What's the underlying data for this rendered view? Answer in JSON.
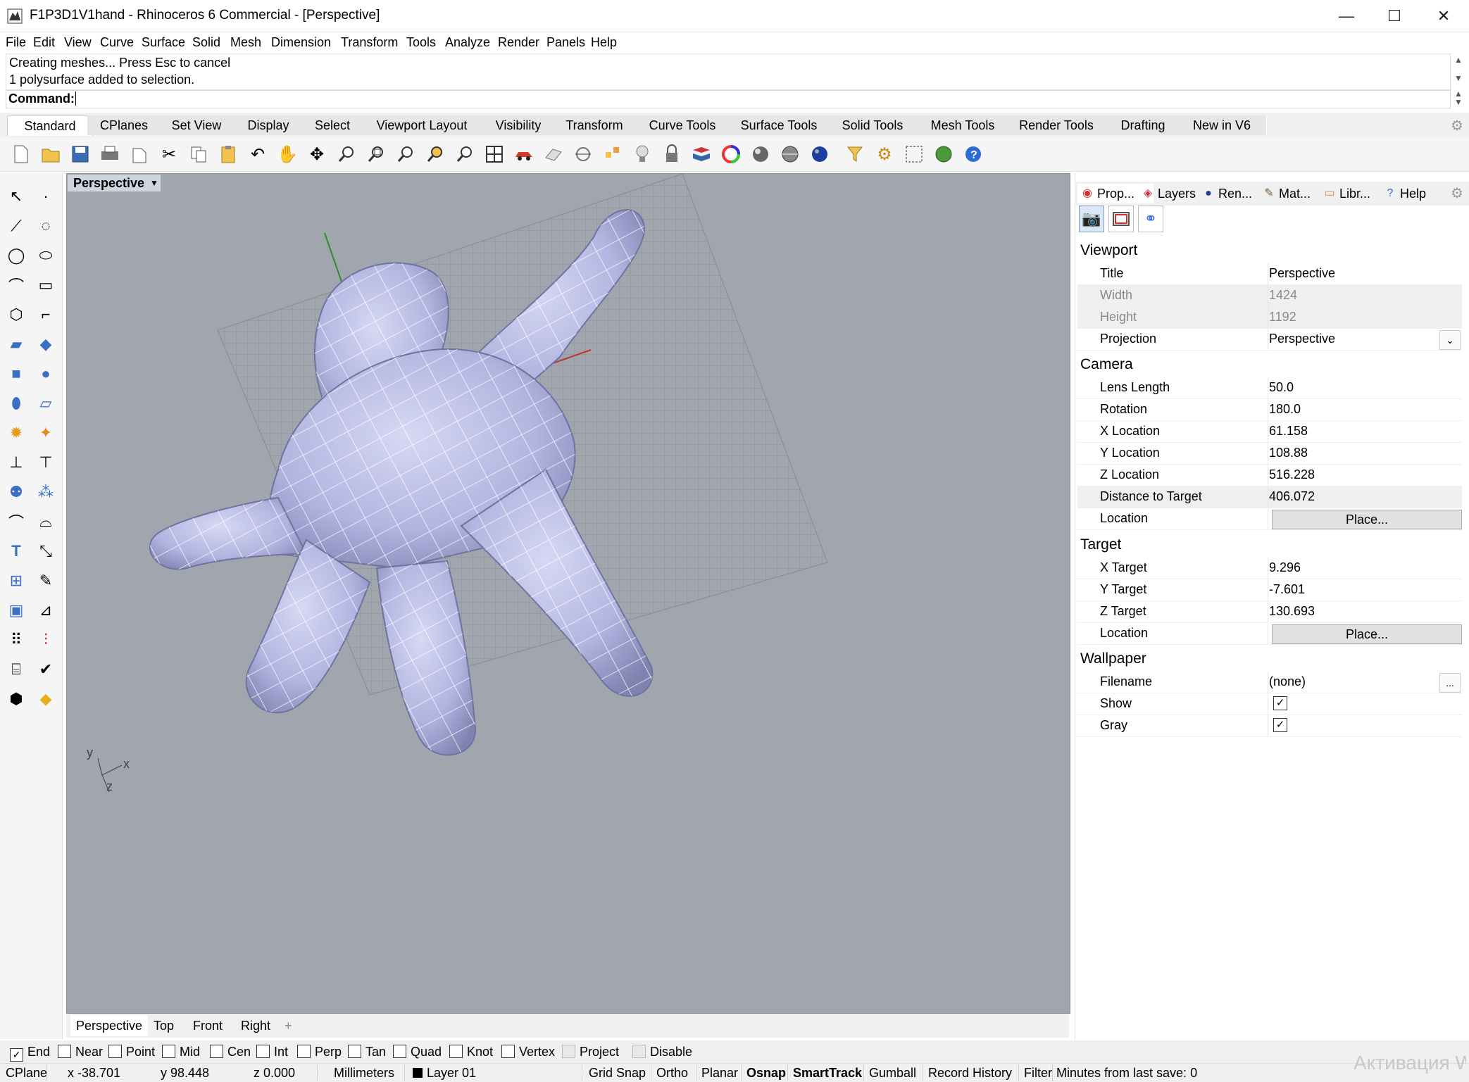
{
  "window": {
    "title": "F1P3D1V1hand - Rhinoceros 6 Commercial - [Perspective]",
    "minimize": "—",
    "maximize": "☐",
    "close": "✕"
  },
  "menu": [
    "File",
    "Edit",
    "View",
    "Curve",
    "Surface",
    "Solid",
    "Mesh",
    "Dimension",
    "Transform",
    "Tools",
    "Analyze",
    "Render",
    "Panels",
    "Help"
  ],
  "command": {
    "history": [
      "Creating meshes... Press Esc to cancel",
      "1 polysurface added to selection."
    ],
    "prompt": "Command:",
    "value": ""
  },
  "toolbar_tabs": [
    "Standard",
    "CPlanes",
    "Set View",
    "Display",
    "Select",
    "Viewport Layout",
    "Visibility",
    "Transform",
    "Curve Tools",
    "Surface Tools",
    "Solid Tools",
    "Mesh Tools",
    "Render Tools",
    "Drafting",
    "New in V6"
  ],
  "toolbar_icons": [
    "new-file",
    "open",
    "save",
    "print",
    "import",
    "cut",
    "copy",
    "paste",
    "undo",
    "pan",
    "rotate-view",
    "zoom",
    "zoom-window",
    "zoom-extents",
    "zoom-selected",
    "undo-view",
    "four-viewports",
    "car-render",
    "grid",
    "osnap",
    "gumball",
    "light",
    "lock",
    "layer-book",
    "color-wheel",
    "shade-sphere",
    "render-sphere",
    "blue-sphere",
    "filter",
    "settings-gears",
    "grip",
    "render-globe",
    "help"
  ],
  "viewport": {
    "name": "Perspective",
    "axes": {
      "x": "x",
      "y": "y",
      "z": "z"
    },
    "tabs": [
      "Perspective",
      "Top",
      "Front",
      "Right"
    ],
    "add_tab": "+"
  },
  "panel": {
    "tabs": [
      "Prop...",
      "Layers",
      "Ren...",
      "Mat...",
      "Libr...",
      "Help"
    ],
    "sections": {
      "viewport": {
        "heading": "Viewport",
        "title_label": "Title",
        "title": "Perspective",
        "width_label": "Width",
        "width": "1424",
        "height_label": "Height",
        "height": "1192",
        "projection_label": "Projection",
        "projection": "Perspective"
      },
      "camera": {
        "heading": "Camera",
        "lens_label": "Lens Length",
        "lens": "50.0",
        "rotation_label": "Rotation",
        "rotation": "180.0",
        "x_label": "X Location",
        "x": "61.158",
        "y_label": "Y Location",
        "y": "108.88",
        "z_label": "Z Location",
        "z": "516.228",
        "dist_label": "Distance to Target",
        "dist": "406.072",
        "loc_label": "Location",
        "place": "Place..."
      },
      "target": {
        "heading": "Target",
        "x_label": "X Target",
        "x": "9.296",
        "y_label": "Y Target",
        "y": "-7.601",
        "z_label": "Z Target",
        "z": "130.693",
        "loc_label": "Location",
        "place": "Place..."
      },
      "wallpaper": {
        "heading": "Wallpaper",
        "filename_label": "Filename",
        "filename": "(none)",
        "browse": "...",
        "show_label": "Show",
        "show": true,
        "gray_label": "Gray",
        "gray": true
      }
    }
  },
  "osnaps": [
    {
      "label": "End",
      "checked": true
    },
    {
      "label": "Near",
      "checked": false
    },
    {
      "label": "Point",
      "checked": false
    },
    {
      "label": "Mid",
      "checked": false
    },
    {
      "label": "Cen",
      "checked": false
    },
    {
      "label": "Int",
      "checked": false
    },
    {
      "label": "Perp",
      "checked": false
    },
    {
      "label": "Tan",
      "checked": false
    },
    {
      "label": "Quad",
      "checked": false
    },
    {
      "label": "Knot",
      "checked": false
    },
    {
      "label": "Vertex",
      "checked": false
    },
    {
      "label": "Project",
      "checked": false
    },
    {
      "label": "Disable",
      "checked": false
    }
  ],
  "status": {
    "cplane": "CPlane",
    "x": "x -38.701",
    "y": "y 98.448",
    "z": "z 0.000",
    "units": "Millimeters",
    "layer": "Layer 01",
    "grid_snap": "Grid Snap",
    "ortho": "Ortho",
    "planar": "Planar",
    "osnap": "Osnap",
    "smarttrack": "SmartTrack",
    "gumball": "Gumball",
    "record_history": "Record History",
    "filter": "Filter",
    "minutes": "Minutes from last save: 0"
  },
  "watermark": "Активация W",
  "colors": {
    "viewport_bg": "#a1a6ae",
    "model": "#b9bce4",
    "wire": "#ffffff",
    "active_tab": "#cfd5de"
  }
}
